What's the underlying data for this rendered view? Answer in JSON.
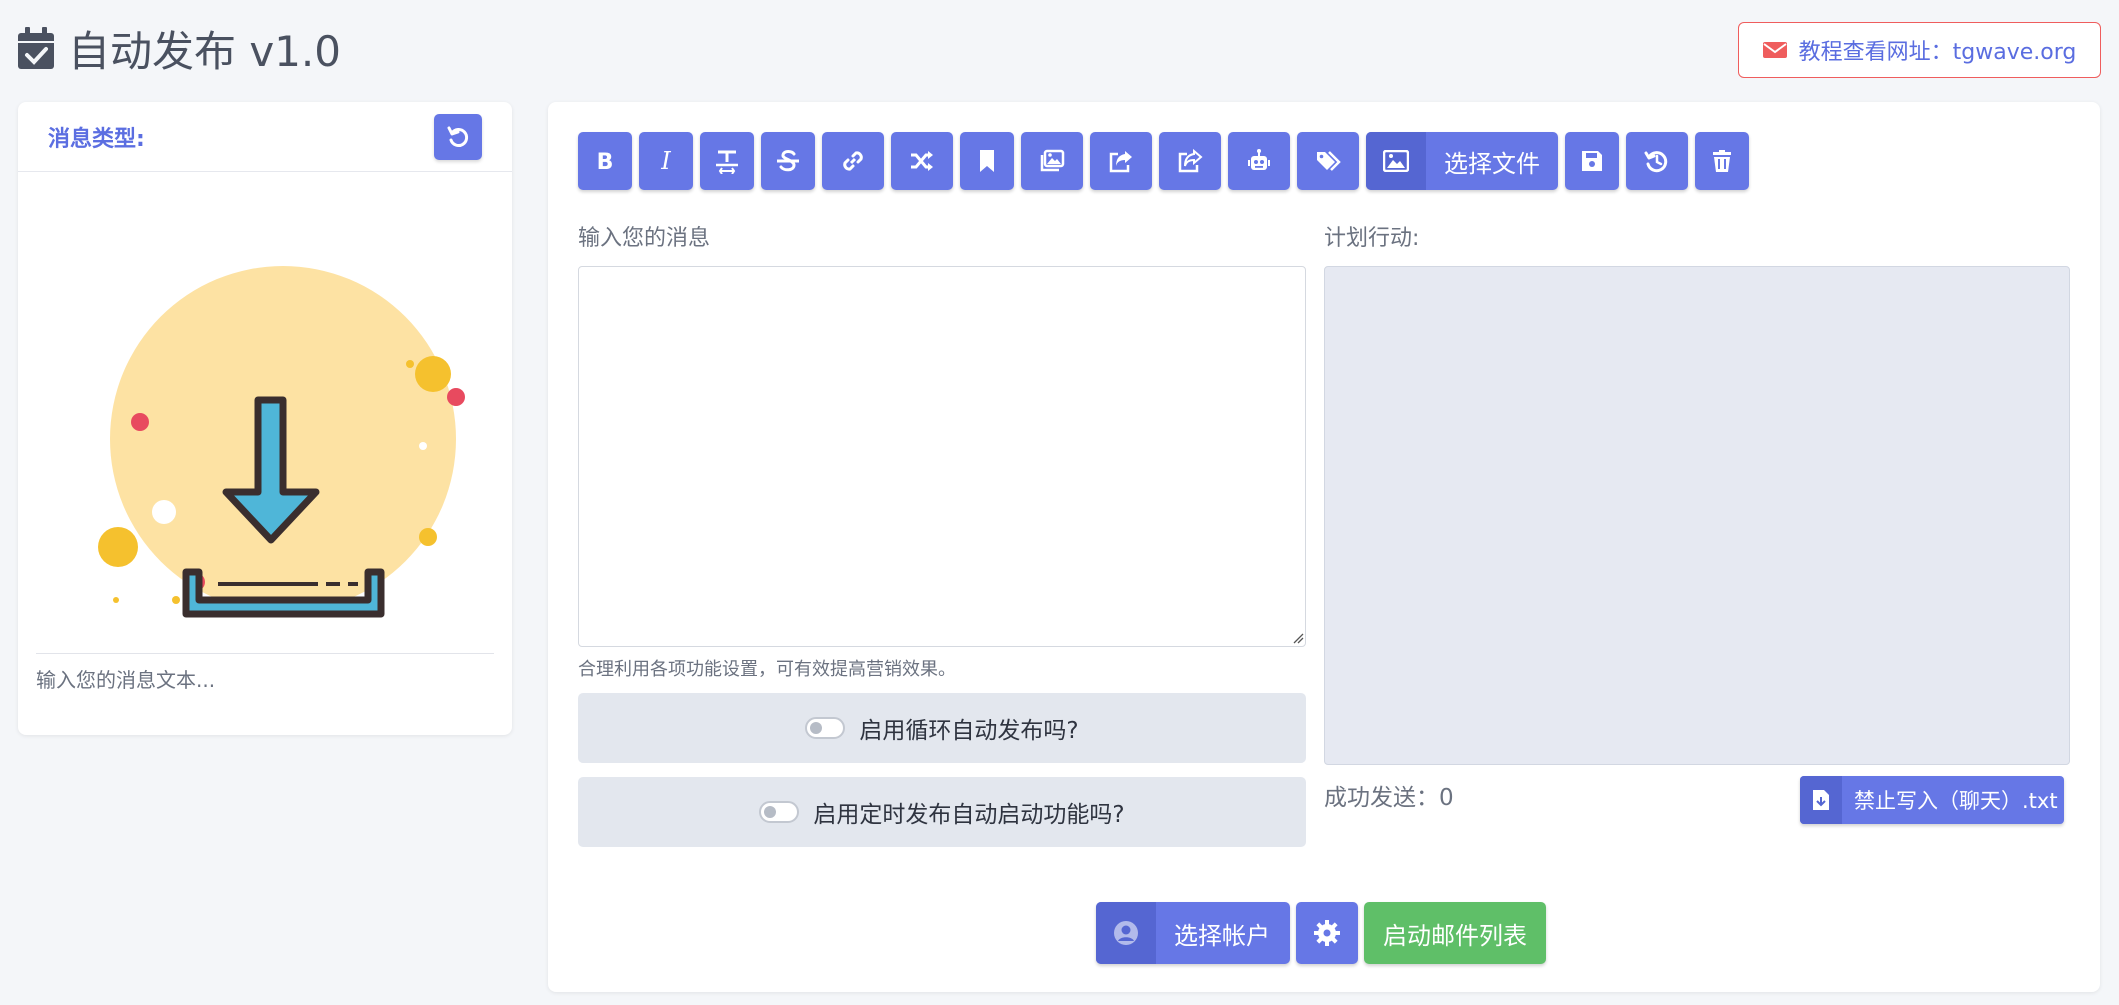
{
  "header": {
    "title": "自动发布 v1.0",
    "tutorial_link": "教程查看网址：tgwave.org"
  },
  "left_panel": {
    "label": "消息类型:",
    "preview_text": "输入您的消息文本..."
  },
  "toolbar": {
    "buttons": [
      {
        "icon": "bold-icon"
      },
      {
        "icon": "italic-icon"
      },
      {
        "icon": "text-format-icon"
      },
      {
        "icon": "strikethrough-icon"
      },
      {
        "icon": "link-icon"
      },
      {
        "icon": "shuffle-icon"
      },
      {
        "icon": "bookmark-icon"
      },
      {
        "icon": "images-icon"
      },
      {
        "icon": "share-square-icon"
      },
      {
        "icon": "share-icon"
      },
      {
        "icon": "robot-icon"
      },
      {
        "icon": "tags-icon"
      }
    ],
    "select_file_label": "选择文件"
  },
  "message": {
    "label": "输入您的消息",
    "value": "",
    "hint": "合理利用各项功能设置，可有效提高营销效果。"
  },
  "toggles": {
    "loop_label": "启用循环自动发布吗?",
    "loop_enabled": false,
    "timer_label": "启用定时发布自动启动功能吗?",
    "timer_enabled": false
  },
  "plan": {
    "label": "计划行动:",
    "success_label": "成功发送：",
    "success_count": "0",
    "export_label": "禁止写入（聊天）.txt"
  },
  "bottom": {
    "select_account_label": "选择帐户",
    "start_label": "启动邮件列表"
  },
  "colors": {
    "primary": "#6677e6",
    "primary_dark": "#5566d2",
    "success": "#5fbf68",
    "danger": "#ef5d5d"
  }
}
